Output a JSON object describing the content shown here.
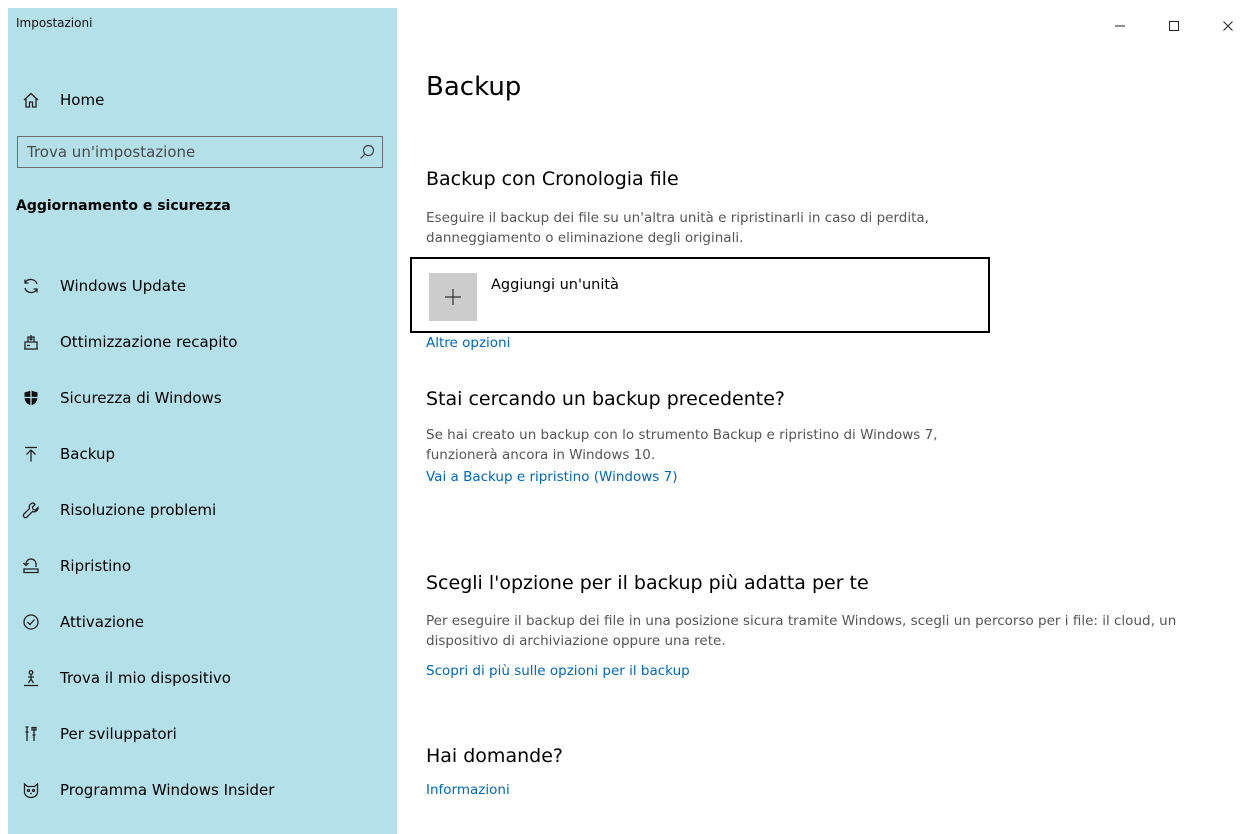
{
  "window": {
    "title": "Impostazioni"
  },
  "sidebar": {
    "home_label": "Home",
    "search_placeholder": "Trova un'impostazione",
    "section_title": "Aggiornamento e sicurezza",
    "items": [
      {
        "label": "Windows Update",
        "icon": "refresh-icon"
      },
      {
        "label": "Ottimizzazione recapito",
        "icon": "delivery-optimization-icon"
      },
      {
        "label": "Sicurezza di Windows",
        "icon": "shield-icon"
      },
      {
        "label": "Backup",
        "icon": "upload-arrow-icon"
      },
      {
        "label": "Risoluzione problemi",
        "icon": "wrench-icon"
      },
      {
        "label": "Ripristino",
        "icon": "recovery-icon"
      },
      {
        "label": "Attivazione",
        "icon": "check-circle-icon"
      },
      {
        "label": "Trova il mio dispositivo",
        "icon": "person-locate-icon"
      },
      {
        "label": "Per sviluppatori",
        "icon": "developer-tools-icon"
      },
      {
        "label": "Programma Windows Insider",
        "icon": "insider-cat-icon"
      }
    ]
  },
  "main": {
    "title": "Backup",
    "file_history": {
      "heading": "Backup con Cronologia file",
      "description": "Eseguire il backup dei file su un'altra unità e ripristinarli in caso di perdita, danneggiamento o eliminazione degli originali.",
      "add_drive_label": "Aggiungi un'unità",
      "more_options_link": "Altre opzioni"
    },
    "older_backup": {
      "heading": "Stai cercando un backup precedente?",
      "description": "Se hai creato un backup con lo strumento Backup e ripristino di Windows 7, funzionerà ancora in Windows 10.",
      "link": "Vai a Backup e ripristino (Windows 7)"
    },
    "choose_option": {
      "heading": "Scegli l'opzione per il backup più adatta per te",
      "description": "Per eseguire il backup dei file in una posizione sicura tramite Windows, scegli un percorso per i file: il cloud, un dispositivo di archiviazione oppure una rete.",
      "link": "Scopri di più sulle opzioni per il backup"
    },
    "questions": {
      "heading": "Hai domande?",
      "link": "Informazioni"
    }
  },
  "colors": {
    "sidebar_bg": "#b4e0ea",
    "link": "#0067b8",
    "body_text": "#555555"
  }
}
